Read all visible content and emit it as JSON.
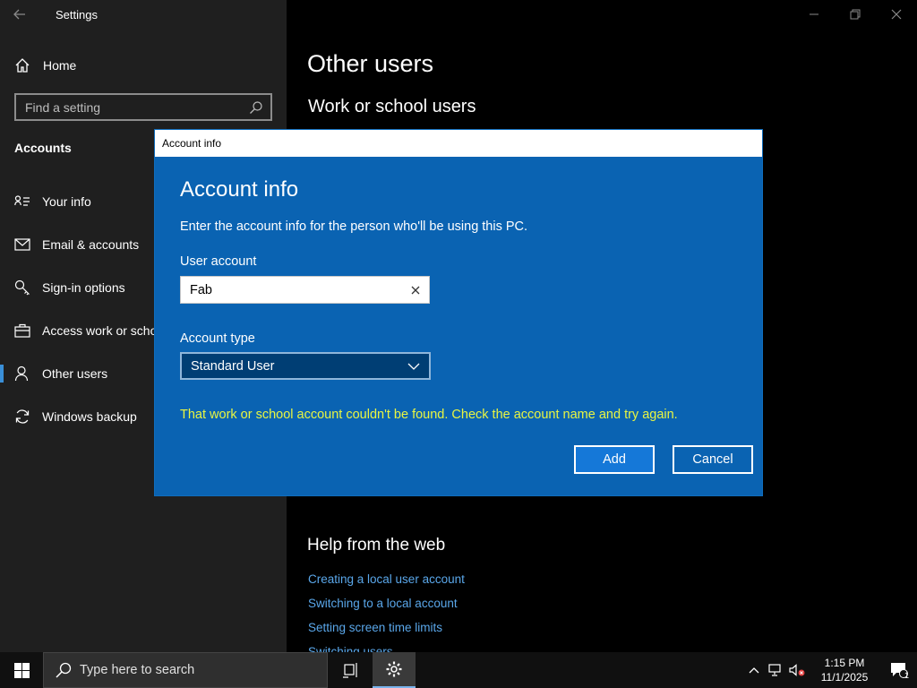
{
  "app": {
    "title": "Settings"
  },
  "sidebar": {
    "home_label": "Home",
    "search_placeholder": "Find a setting",
    "section_label": "Accounts",
    "items": [
      {
        "label": "Your info",
        "icon": "person-card-icon"
      },
      {
        "label": "Email & accounts",
        "icon": "mail-icon"
      },
      {
        "label": "Sign-in options",
        "icon": "key-icon"
      },
      {
        "label": "Access work or scho",
        "icon": "briefcase-icon"
      },
      {
        "label": "Other users",
        "icon": "users-icon",
        "selected": true
      },
      {
        "label": "Windows backup",
        "icon": "sync-icon"
      }
    ]
  },
  "main": {
    "title": "Other users",
    "subheading": "Work or school users",
    "help_title": "Help from the web",
    "help_links": [
      "Creating a local user account",
      "Switching to a local account",
      "Setting screen time limits",
      "Switching users"
    ]
  },
  "dialog": {
    "window_title": "Account info",
    "heading": "Account info",
    "description": "Enter the account info for the person who'll be using this PC.",
    "user_account_label": "User account",
    "user_account_value": "Fab",
    "account_type_label": "Account type",
    "account_type_value": "Standard User",
    "error": "That work or school account couldn't be found. Check the account name and try again.",
    "add_label": "Add",
    "cancel_label": "Cancel"
  },
  "taskbar": {
    "search_placeholder": "Type here to search",
    "time": "1:15 PM",
    "date": "11/1/2025",
    "notification_count": "1"
  },
  "colors": {
    "dialog_bg": "#0a63b2",
    "accent": "#3a8fd8",
    "error": "#e8f542",
    "link": "#5aa7ea"
  }
}
